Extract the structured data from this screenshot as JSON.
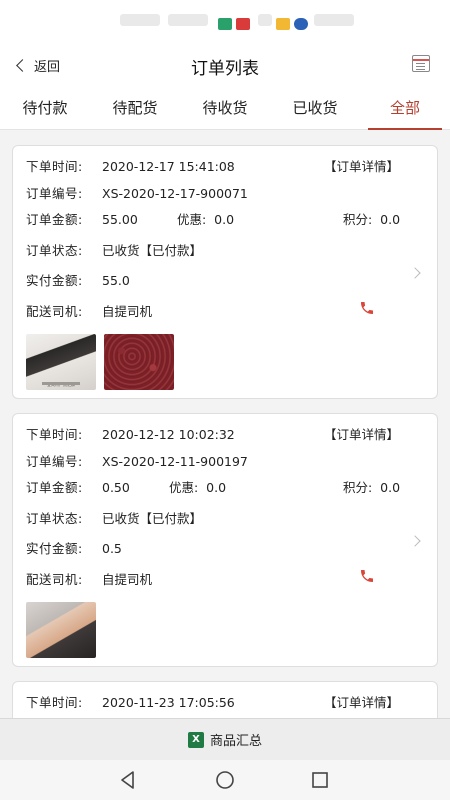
{
  "header": {
    "back_label": "返回",
    "title": "订单列表"
  },
  "tabs": [
    {
      "label": "待付款",
      "active": false
    },
    {
      "label": "待配货",
      "active": false
    },
    {
      "label": "待收货",
      "active": false
    },
    {
      "label": "已收货",
      "active": false
    },
    {
      "label": "全部",
      "active": true
    }
  ],
  "labels": {
    "order_time": "下单时间:",
    "order_no": "订单编号:",
    "amount": "订单金额:",
    "discount": "优惠:",
    "points": "积分:",
    "status": "订单状态:",
    "paid": "实付金额:",
    "driver": "配送司机:",
    "detail": "【订单详情】"
  },
  "orders": [
    {
      "time": "2020-12-17 15:41:08",
      "number": "XS-2020-12-17-900071",
      "amount": "55.00",
      "discount": "0.0",
      "points": "0.0",
      "status": "已收货【已付款】",
      "paid": "55.0",
      "driver": "自提司机",
      "thumb_caption": "宜宾特产黑芝麻"
    },
    {
      "time": "2020-12-12 10:02:32",
      "number": "XS-2020-12-11-900197",
      "amount": "0.50",
      "discount": "0.0",
      "points": "0.0",
      "status": "已收货【已付款】",
      "paid": "0.5",
      "driver": "自提司机"
    },
    {
      "time": "2020-11-23 17:05:56"
    }
  ],
  "bottom": {
    "label": "商品汇总"
  },
  "colors": {
    "accent": "#b5402f",
    "phone": "#d9463b",
    "excel": "#1f7a43"
  }
}
